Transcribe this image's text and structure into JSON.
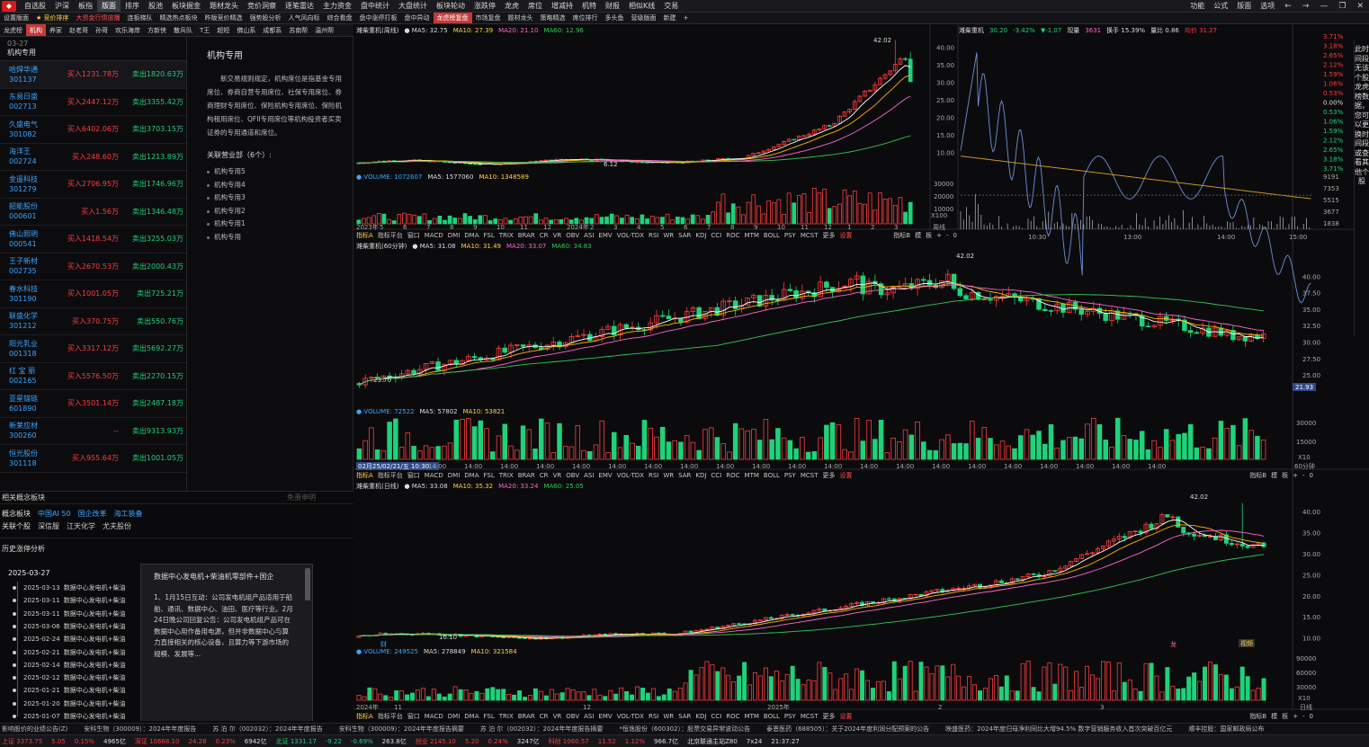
{
  "menubar": {
    "items": [
      "自选股",
      "沪深",
      "板指",
      "版面",
      "排序",
      "股池",
      "板块掘金",
      "题材龙头",
      "竞价洞察",
      "逐笔雷达",
      "主力资金",
      "盘中统计",
      "大盘统计",
      "板块轮动",
      "涨跌停",
      "龙虎",
      "席位",
      "增减持",
      "机特",
      "财报",
      "相似K线",
      "交易"
    ],
    "active_index": 3,
    "right": [
      "功能",
      "公式",
      "版面",
      "选项"
    ],
    "window_controls": [
      "←",
      "→",
      "—",
      "❐",
      "✕"
    ]
  },
  "subbar": {
    "items": [
      "设置版面",
      "★ 竞价排序",
      "大资金行情放播",
      "连板梯队",
      "精选热点板块",
      "昨版竞价精选",
      "强势股分析",
      "人气风向标",
      "综合看盘",
      "盘中涨停打板",
      "盘中异动",
      "龙虎榜复盘",
      "市场复盘",
      "题材龙头",
      "策略精选",
      "席位排行",
      "多头鱼",
      "营级版面",
      "新建",
      "+"
    ],
    "active_index": 11
  },
  "blockbar": {
    "items": [
      "龙虎榜",
      "机构",
      "养家",
      "赵老哥",
      "孙哥",
      "欢乐海岸",
      "方新侠",
      "散兵队",
      "T王",
      "超短",
      "佛山系",
      "成都系",
      "苏南帮",
      "温州帮"
    ],
    "active_index": 1
  },
  "leftlist": {
    "date": "03-27",
    "title": "机构专用",
    "rows": [
      {
        "name": "哈焊华通",
        "code": "301137",
        "buy": "买入1231.78万",
        "sell": "卖出1820.63万"
      },
      {
        "name": "东易日盛",
        "code": "002713",
        "buy": "买入2447.12万",
        "sell": "卖出3355.42万"
      },
      {
        "name": "久盛电气",
        "code": "301082",
        "buy": "买入6402.06万",
        "sell": "卖出3703.15万"
      },
      {
        "name": "海洋王",
        "code": "002724",
        "buy": "买入248.60万",
        "sell": "卖出1213.89万"
      },
      {
        "name": "金遥科技",
        "code": "301279",
        "buy": "买入2706.95万",
        "sell": "卖出1746.96万"
      },
      {
        "name": "韶能股份",
        "code": "000601",
        "buy": "买入1.56万",
        "sell": "卖出1346.48万"
      },
      {
        "name": "佛山照明",
        "code": "000541",
        "buy": "买入1418.54万",
        "sell": "卖出3255.03万"
      },
      {
        "name": "王子新材",
        "code": "002735",
        "buy": "买入2670.53万",
        "sell": "卖出2000.43万"
      },
      {
        "name": "春水科技",
        "code": "301190",
        "buy": "买入1001.05万",
        "sell": "卖出725.21万"
      },
      {
        "name": "联盛化学",
        "code": "301212",
        "buy": "买入370.75万",
        "sell": "卖出550.76万"
      },
      {
        "name": "阳光乳业",
        "code": "001318",
        "buy": "买入3317.12万",
        "sell": "卖出5692.27万"
      },
      {
        "name": "红 宝 丽",
        "code": "002165",
        "buy": "买入5576.50万",
        "sell": "卖出2270.15万"
      },
      {
        "name": "亚星锚链",
        "code": "601890",
        "buy": "买入3501.14万",
        "sell": "卖出2487.18万"
      },
      {
        "name": "新莱应材",
        "code": "300260",
        "buy": "--",
        "sell": "卖出9313.93万"
      },
      {
        "name": "恒光股份",
        "code": "301118",
        "buy": "买入955.64万",
        "sell": "卖出1001.05万"
      }
    ]
  },
  "midpanel": {
    "title": "机构专用",
    "desc": "新交易规则规定，机构席位是指基金专用席位、券商自营专用席位、社保专用席位、券商理财专用席位、保险机构专用席位、保险机构租用席位、QFII专用席位等机构投资者买卖证券的专用通道和席位。",
    "related_title": "关联营业部（6个）:",
    "related": [
      "机构专用5",
      "机构专用4",
      "机构专用3",
      "机构专用2",
      "机构专用1",
      "机构专用"
    ]
  },
  "concept": {
    "header": "相关概念板块",
    "disclaimer": "免责申明",
    "concept_label": "概念板块",
    "concepts": [
      "中国AI 50",
      "国企改革",
      "海工装备"
    ],
    "related_label": "关联个股",
    "related_stocks": [
      "深信服",
      "江天化学",
      "尤夫股份"
    ],
    "history_title": "历史涨停分析",
    "current_date": "2025-03-27",
    "timeline": [
      {
        "date": "2025-03-13",
        "text": "数据中心发电机+柴油"
      },
      {
        "date": "2025-03-11",
        "text": "数据中心发电机+柴油"
      },
      {
        "date": "2025-03-11",
        "text": "数据中心发电机+柴油"
      },
      {
        "date": "2025-03-06",
        "text": "数据中心发电机+柴油"
      },
      {
        "date": "2025-02-24",
        "text": "数据中心发电机+柴油"
      },
      {
        "date": "2025-02-21",
        "text": "数据中心发电机+柴油"
      },
      {
        "date": "2025-02-14",
        "text": "数据中心发电机+柴油"
      },
      {
        "date": "2025-02-12",
        "text": "数据中心发电机+柴油"
      },
      {
        "date": "2025-01-21",
        "text": "数据中心发电机+柴油"
      },
      {
        "date": "2025-01-20",
        "text": "数据中心发电机+柴油"
      },
      {
        "date": "2025-01-07",
        "text": "数据中心发电机+柴油"
      }
    ],
    "popup_title": "数据中心发电机+柴油机零部件+国企",
    "popup_body": "1、1月15日互动：公司发电机组产品适用于船舶、通讯、数据中心、油田、医疗等行业。2月24日晚公司回复公告：公司发电机组产品可在数据中心用作备用电源，但并非数据中心与算力直接相关的核心设备，且算力等下游市场的规模、发展等..."
  },
  "weekly": {
    "header": [
      {
        "t": "潍柴重机(周线)",
        "c": "wh"
      },
      {
        "t": "● MA5: 32.75",
        "c": "wh"
      },
      {
        "t": "MA10: 27.39",
        "c": "yl"
      },
      {
        "t": "MA20: 21.10",
        "c": "pk"
      },
      {
        "t": "MA60: 12.96",
        "c": "gr"
      }
    ],
    "peak_label": "42.02",
    "low_label": "6.12",
    "vol_header": [
      {
        "t": "● VOLUME: 1072607",
        "c": "bl"
      },
      {
        "t": "MA5: 1577060",
        "c": "wh"
      },
      {
        "t": "MA10: 1348589",
        "c": "yl"
      }
    ],
    "xlabels": [
      "2023年",
      "5",
      "6",
      "7",
      "8",
      "9",
      "10",
      "11",
      "12",
      "2024年",
      "2",
      "3",
      "4",
      "5",
      "6",
      "7",
      "8",
      "9",
      "10",
      "11",
      "12",
      "1",
      "2",
      "3"
    ],
    "yticks": [
      "40.00",
      "35.00",
      "30.00",
      "25.00",
      "20.00",
      "15.00",
      "10.00"
    ],
    "unit": "周线",
    "x100": "X100"
  },
  "intraday": {
    "header": [
      {
        "t": "潍柴重机",
        "c": "wh"
      },
      {
        "t": "30.20",
        "c": "dn"
      },
      {
        "t": "-3.42%",
        "c": "dn"
      },
      {
        "t": "▼-1.07",
        "c": "dn"
      },
      {
        "t": "现量",
        "c": "wh"
      },
      {
        "t": "3631",
        "c": "pk"
      },
      {
        "t": "换手 15.39%",
        "c": "wh"
      },
      {
        "t": "量比 0.86",
        "c": "wh"
      },
      {
        "t": "均价 31.27",
        "c": "up"
      }
    ],
    "pct_ticks": [
      "3.71%",
      "3.18%",
      "2.65%",
      "2.12%",
      "1.59%",
      "1.06%",
      "0.53%",
      "0.00%",
      "0.53%",
      "1.06%",
      "1.59%",
      "2.12%",
      "2.65%",
      "3.18%",
      "3.71%"
    ],
    "left_ticks": [
      "40.00",
      "35.00",
      "30.00",
      "25.00",
      "20.00",
      "15.00",
      "10.00"
    ],
    "vol_left": [
      "30000",
      "20000",
      "10000"
    ],
    "vol_right": [
      "9191",
      "7353",
      "5515",
      "3677",
      "1838"
    ],
    "times": [
      "10:30",
      "13:00",
      "14:00",
      "15:00"
    ],
    "x100": "X100"
  },
  "tabs1": {
    "items": [
      "指标A",
      "指标平台",
      "窗口",
      "MACD",
      "DMI",
      "DMA",
      "FSL",
      "TRIX",
      "BRAR",
      "CR",
      "VR",
      "OBV",
      "ASI",
      "EMV",
      "VOL-TDX",
      "RSI",
      "WR",
      "SAR",
      "KDJ",
      "CCI",
      "ROC",
      "MTM",
      "BOLL",
      "PSY",
      "MCST",
      "更多",
      "设置"
    ],
    "right": [
      "指标B",
      "模",
      "板",
      "+",
      "-",
      "0"
    ]
  },
  "min60": {
    "header": [
      {
        "t": "潍柴重机(60分钟)",
        "c": "wh"
      },
      {
        "t": "● MA5: 31.08",
        "c": "wh"
      },
      {
        "t": "MA10: 31.49",
        "c": "yl"
      },
      {
        "t": "MA20: 33.07",
        "c": "pk"
      },
      {
        "t": "MA60: 34.83",
        "c": "gr"
      }
    ],
    "peak_label": "42.02",
    "low_label": "23.70",
    "cursor_price": "21.93",
    "yticks": [
      "40.00",
      "37.50",
      "35.00",
      "32.50",
      "30.00",
      "27.50",
      "25.00"
    ],
    "vol_header": [
      {
        "t": "● VOLUME: 72522",
        "c": "bl"
      },
      {
        "t": "MA5: 57802",
        "c": "wh"
      },
      {
        "t": "MA10: 53821",
        "c": "yl"
      }
    ],
    "vol_ticks": [
      "30000",
      "15000"
    ],
    "time_label": "02月25/02/21/五 10:30",
    "xlabels": [
      "14:00",
      "14:00",
      "14:00",
      "14:00",
      "14:00",
      "14:00",
      "14:00",
      "14:00",
      "14:00",
      "14:00",
      "14:00",
      "14:00",
      "14:00",
      "14:00",
      "14:00",
      "14:00",
      "14:00",
      "14:00",
      "14:00",
      "14:00",
      "14:00",
      "14:00",
      "14:00"
    ],
    "unit": "60分钟",
    "x10": "X10"
  },
  "tabs2": {
    "items": [
      "指标A",
      "指标平台",
      "窗口",
      "MACD",
      "DMI",
      "DMA",
      "FSL",
      "TRIX",
      "BRAR",
      "CR",
      "VR",
      "OBV",
      "ASI",
      "EMV",
      "VOL-TDX",
      "RSI",
      "WR",
      "SAR",
      "KDJ",
      "CCI",
      "ROC",
      "MTM",
      "BOLL",
      "PSY",
      "MCST",
      "更多",
      "设置"
    ],
    "right": [
      "指标B",
      "模",
      "板",
      "+",
      "-",
      "0"
    ]
  },
  "daily": {
    "header": [
      {
        "t": "潍柴重机(日线)",
        "c": "wh"
      },
      {
        "t": "● MA5: 33.08",
        "c": "wh"
      },
      {
        "t": "MA10: 35.32",
        "c": "yl"
      },
      {
        "t": "MA20: 33.24",
        "c": "pk"
      },
      {
        "t": "MA60: 25.05",
        "c": "gr"
      }
    ],
    "peak_label": "42.02",
    "low_label": "10.10",
    "yticks": [
      "40.00",
      "35.00",
      "30.00",
      "25.00",
      "20.00",
      "15.00",
      "10.00"
    ],
    "vol_header": [
      {
        "t": "● VOLUME: 249525",
        "c": "bl"
      },
      {
        "t": "MA5: 278849",
        "c": "wh"
      },
      {
        "t": "MA10: 321584",
        "c": "yl"
      }
    ],
    "vol_ticks": [
      "90000",
      "60000",
      "30000"
    ],
    "xlabels": [
      "2024年",
      "11",
      "12",
      "2025年",
      "2",
      "3"
    ],
    "unit": "日线",
    "x10": "X10",
    "marker1": "财",
    "marker2": "龙",
    "marker3": "视频"
  },
  "tabs3": {
    "items": [
      "指标A",
      "指标平台",
      "窗口",
      "MACD",
      "DMI",
      "DMA",
      "FSL",
      "TRIX",
      "BRAR",
      "CR",
      "VR",
      "OBV",
      "ASI",
      "EMV",
      "VOL-TDX",
      "RSI",
      "WR",
      "SAR",
      "KDJ",
      "CCI",
      "ROC",
      "MTM",
      "BOLL",
      "PSY",
      "MCST",
      "更多",
      "设置"
    ],
    "right": [
      "指标B",
      "模",
      "板",
      "+",
      "-",
      "0"
    ]
  },
  "sidevert": {
    "text": "此时间段无该个股龙虎榜数据，您可以更换时间段或查看其他个股"
  },
  "ticker": [
    "影响股价的业绩公告(Z)",
    "安科生物（300009）：2024年年度报告",
    "苏 泊 尔（002032）：2024年年度报告",
    "安科生物（300009）：2024年年度报告摘要",
    "苏 泊 尔（002032）：2024年年度报告摘要",
    "*恒逸股份（600302）：股票交易异常波动公告",
    "泰恩医药（688505）：关于2024年度利润分配预案的公告",
    "映盛医药：2024年度归母净利同比大增94.5% 数字营销服务收入首次突破百亿元",
    "顺丰控股：国家邮政局公布"
  ],
  "status": [
    {
      "t": "上证 3373.75",
      "c": "up"
    },
    {
      "t": "5.05",
      "c": "up"
    },
    {
      "t": "0.15%",
      "c": "up"
    },
    {
      "t": "4965亿",
      "c": "wh"
    },
    {
      "t": "深证 10668.10",
      "c": "up"
    },
    {
      "t": "24.28",
      "c": "up"
    },
    {
      "t": "0.23%",
      "c": "up"
    },
    {
      "t": "6942亿",
      "c": "wh"
    },
    {
      "t": "北证 1331.17",
      "c": "dn"
    },
    {
      "t": "-9.22",
      "c": "dn"
    },
    {
      "t": "-0.69%",
      "c": "dn"
    },
    {
      "t": "263.8亿",
      "c": "wh"
    },
    {
      "t": "创业 2145.10",
      "c": "up"
    },
    {
      "t": "5.20",
      "c": "up"
    },
    {
      "t": "0.24%",
      "c": "up"
    },
    {
      "t": "3247亿",
      "c": "wh"
    },
    {
      "t": "科创 1060.57",
      "c": "up"
    },
    {
      "t": "11.52",
      "c": "up"
    },
    {
      "t": "1.12%",
      "c": "up"
    },
    {
      "t": "966.7亿",
      "c": "wh"
    },
    {
      "t": "北京联通主站Z80",
      "c": "wh"
    },
    {
      "t": "7x24",
      "c": "wh"
    },
    {
      "t": "21:37:27",
      "c": "wh"
    }
  ],
  "colors": {
    "up": "#ff3c3c",
    "down": "#1fd27a",
    "ma5": "#ffffff",
    "ma10": "#ffb400",
    "ma20": "#ff66cc",
    "ma60": "#34c759",
    "price": "#6f8fd8",
    "avg": "#d9a21a"
  }
}
